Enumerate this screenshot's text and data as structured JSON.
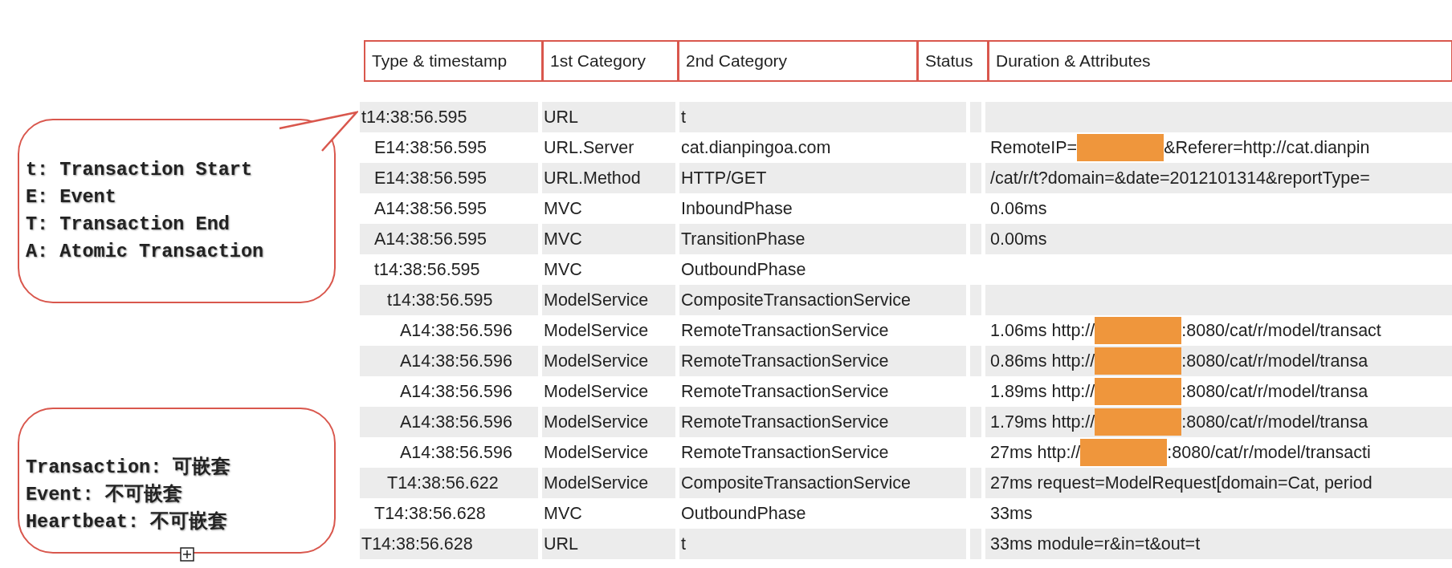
{
  "callouts": [
    {
      "lines": [
        "t: Transaction Start",
        "E: Event",
        "T: Transaction End",
        "A: Atomic Transaction"
      ],
      "pointer": true,
      "handle": false
    },
    {
      "lines": [
        "Transaction: 可嵌套",
        "Event: 不可嵌套",
        "Heartbeat: 不可嵌套"
      ],
      "pointer": false,
      "handle": true
    }
  ],
  "table": {
    "columns": [
      "Type & timestamp",
      "1st Category",
      "2nd Category",
      "Status",
      "Duration & Attributes"
    ],
    "rows": [
      {
        "type_timestamp": "t14:38:56.595",
        "category_1": "URL",
        "category_2": "t",
        "children": [
          {
            "type_timestamp": "E14:38:56.595",
            "category_1": "URL.Server",
            "category_2": "cat.dianpingoa.com",
            "duration": [
              {
                "kind": "text",
                "text": "RemoteIP="
              },
              {
                "kind": "redacted"
              },
              {
                "kind": "text",
                "text": "&Referer=http://cat.dianpin"
              }
            ]
          },
          {
            "type_timestamp": "E14:38:56.595",
            "category_1": "URL.Method",
            "category_2": "HTTP/GET",
            "duration": [
              {
                "kind": "text",
                "text": "/cat/r/t?domain=&date=2012101314&reportType="
              }
            ]
          },
          {
            "type_timestamp": "A14:38:56.595",
            "category_1": "MVC",
            "category_2": "InboundPhase",
            "duration": [
              {
                "kind": "text",
                "text": "0.06ms"
              }
            ]
          },
          {
            "type_timestamp": "A14:38:56.595",
            "category_1": "MVC",
            "category_2": "TransitionPhase",
            "duration": [
              {
                "kind": "text",
                "text": "0.00ms"
              }
            ]
          },
          {
            "type_timestamp": "t14:38:56.595",
            "category_1": "MVC",
            "category_2": "OutboundPhase",
            "children": [
              {
                "type_timestamp": "t14:38:56.595",
                "category_1": "ModelService",
                "category_2": "CompositeTransactionService",
                "children": [
                  {
                    "type_timestamp": "A14:38:56.596",
                    "category_1": "ModelService",
                    "category_2": "RemoteTransactionService",
                    "duration": [
                      {
                        "kind": "text",
                        "text": "1.06ms http://"
                      },
                      {
                        "kind": "redacted"
                      },
                      {
                        "kind": "text",
                        "text": ":8080/cat/r/model/transact"
                      }
                    ]
                  },
                  {
                    "type_timestamp": "A14:38:56.596",
                    "category_1": "ModelService",
                    "category_2": "RemoteTransactionService",
                    "duration": [
                      {
                        "kind": "text",
                        "text": "0.86ms http://"
                      },
                      {
                        "kind": "redacted"
                      },
                      {
                        "kind": "text",
                        "text": ":8080/cat/r/model/transa"
                      }
                    ]
                  },
                  {
                    "type_timestamp": "A14:38:56.596",
                    "category_1": "ModelService",
                    "category_2": "RemoteTransactionService",
                    "duration": [
                      {
                        "kind": "text",
                        "text": "1.89ms http://"
                      },
                      {
                        "kind": "redacted"
                      },
                      {
                        "kind": "text",
                        "text": ":8080/cat/r/model/transa"
                      }
                    ]
                  },
                  {
                    "type_timestamp": "A14:38:56.596",
                    "category_1": "ModelService",
                    "category_2": "RemoteTransactionService",
                    "duration": [
                      {
                        "kind": "text",
                        "text": "1.79ms http://"
                      },
                      {
                        "kind": "redacted"
                      },
                      {
                        "kind": "text",
                        "text": ":8080/cat/r/model/transa"
                      }
                    ]
                  },
                  {
                    "type_timestamp": "A14:38:56.596",
                    "category_1": "ModelService",
                    "category_2": "RemoteTransactionService",
                    "duration": [
                      {
                        "kind": "text",
                        "text": "27ms http://"
                      },
                      {
                        "kind": "redacted"
                      },
                      {
                        "kind": "text",
                        "text": ":8080/cat/r/model/transacti"
                      }
                    ]
                  }
                ]
              },
              {
                "type_timestamp": "T14:38:56.622",
                "category_1": "ModelService",
                "category_2": "CompositeTransactionService",
                "duration": [
                  {
                    "kind": "text",
                    "text": "27ms request=ModelRequest[domain=Cat, period"
                  }
                ]
              }
            ]
          },
          {
            "type_timestamp": "T14:38:56.628",
            "category_1": "MVC",
            "category_2": "OutboundPhase",
            "duration": [
              {
                "kind": "text",
                "text": "33ms"
              }
            ]
          }
        ]
      },
      {
        "type_timestamp": "T14:38:56.628",
        "category_1": "URL",
        "category_2": "t",
        "duration": [
          {
            "kind": "text",
            "text": "33ms module=r&in=t&out=t"
          }
        ]
      }
    ]
  }
}
